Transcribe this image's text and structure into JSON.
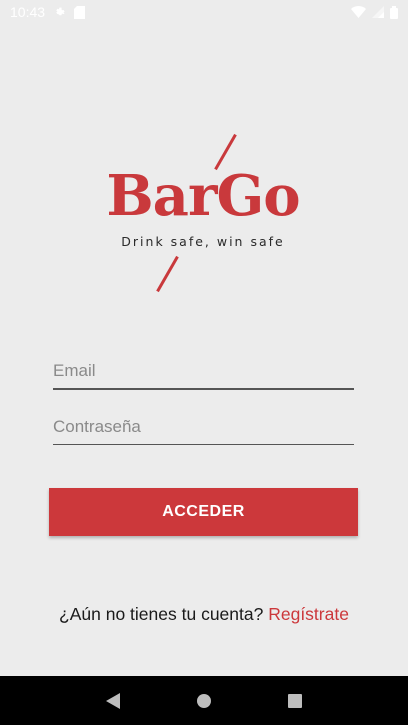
{
  "status_bar": {
    "time": "10:43",
    "icons": [
      "settings-icon",
      "sd-card-icon",
      "wifi-icon",
      "signal-icon",
      "battery-icon"
    ]
  },
  "logo": {
    "title": "BarGo",
    "tagline": "Drink safe, win safe"
  },
  "form": {
    "email_placeholder": "Email",
    "password_placeholder": "Contraseña",
    "login_label": "ACCEDER"
  },
  "signup": {
    "prompt": "¿Aún no tienes tu cuenta?",
    "link": "Regístrate"
  },
  "colors": {
    "accent": "#cc383b",
    "background": "#ececec"
  },
  "nav_bar": {
    "icons": [
      "back-icon",
      "home-icon",
      "recents-icon"
    ]
  }
}
